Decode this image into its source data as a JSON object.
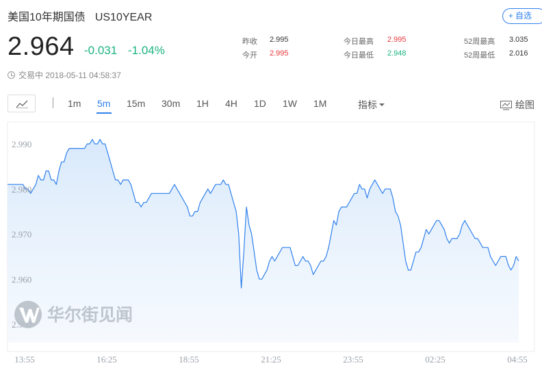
{
  "header": {
    "name": "美国10年期国债",
    "symbol": "US10YEAR",
    "fav_label": "自选",
    "fav_icon": "+",
    "price": "2.964",
    "change": "-0.031",
    "change_pct": "-1.04%",
    "status": "交易中 2018-05-11 04:58:37"
  },
  "stats": [
    {
      "label": "昨收",
      "value": "2.995",
      "tone": "dark"
    },
    {
      "label": "今开",
      "value": "2.995",
      "tone": "red"
    },
    {
      "label": "今日最高",
      "value": "2.995",
      "tone": "red"
    },
    {
      "label": "今日最低",
      "value": "2.948",
      "tone": "green"
    },
    {
      "label": "52周最高",
      "value": "3.035",
      "tone": "dark"
    },
    {
      "label": "52周最低",
      "value": "2.016",
      "tone": "dark"
    }
  ],
  "toolbar": {
    "tabs": [
      "1m",
      "5m",
      "15m",
      "30m",
      "1H",
      "4H",
      "1D",
      "1W",
      "1M"
    ],
    "active_tab": "5m",
    "indicator_label": "指标",
    "draw_label": "绘图"
  },
  "watermark": {
    "text": "华尔街见闻"
  },
  "colors": {
    "line": "#2f80ed",
    "up": "#e8353b",
    "down": "#19b37f",
    "accent": "#2f80ed"
  },
  "chart_data": {
    "type": "area",
    "y_ticks": [
      "2.990",
      "2.980",
      "2.970",
      "2.960",
      "2.950"
    ],
    "x_ticks": [
      "13:55",
      "16:25",
      "18:55",
      "21:25",
      "23:55",
      "02:25",
      "04:55"
    ],
    "ylim": [
      2.947,
      2.995
    ],
    "grid": false,
    "series": [
      {
        "values": [
          2.981,
          2.981,
          2.981,
          2.981,
          2.981,
          2.981,
          2.981,
          2.98,
          2.98,
          2.979,
          2.98,
          2.981,
          2.983,
          2.982,
          2.982,
          2.984,
          2.984,
          2.982,
          2.982,
          2.981,
          2.984,
          2.986,
          2.986,
          2.988,
          2.989,
          2.989,
          2.989,
          2.989,
          2.989,
          2.989,
          2.989,
          2.99,
          2.99,
          2.991,
          2.99,
          2.99,
          2.991,
          2.99,
          2.99,
          2.988,
          2.986,
          2.984,
          2.982,
          2.982,
          2.981,
          2.982,
          2.982,
          2.982,
          2.981,
          2.979,
          2.977,
          2.977,
          2.976,
          2.977,
          2.977,
          2.978,
          2.979,
          2.979,
          2.979,
          2.979,
          2.979,
          2.979,
          2.979,
          2.979,
          2.98,
          2.981,
          2.98,
          2.979,
          2.978,
          2.977,
          2.976,
          2.974,
          2.974,
          2.975,
          2.975,
          2.977,
          2.978,
          2.979,
          2.98,
          2.979,
          2.98,
          2.981,
          2.981,
          2.981,
          2.982,
          2.981,
          2.981,
          2.979,
          2.977,
          2.975,
          2.97,
          2.958,
          2.966,
          2.976,
          2.972,
          2.97,
          2.966,
          2.962,
          2.96,
          2.96,
          2.961,
          2.962,
          2.964,
          2.965,
          2.964,
          2.965,
          2.966,
          2.967,
          2.967,
          2.967,
          2.967,
          2.965,
          2.963,
          2.963,
          2.964,
          2.965,
          2.964,
          2.964,
          2.963,
          2.961,
          2.962,
          2.963,
          2.964,
          2.964,
          2.965,
          2.967,
          2.97,
          2.973,
          2.972,
          2.975,
          2.976,
          2.976,
          2.976,
          2.977,
          2.978,
          2.979,
          2.979,
          2.981,
          2.98,
          2.98,
          2.978,
          2.98,
          2.981,
          2.982,
          2.981,
          2.98,
          2.979,
          2.98,
          2.98,
          2.98,
          2.978,
          2.975,
          2.974,
          2.972,
          2.968,
          2.964,
          2.962,
          2.962,
          2.964,
          2.966,
          2.966,
          2.967,
          2.969,
          2.971,
          2.97,
          2.971,
          2.972,
          2.973,
          2.973,
          2.972,
          2.971,
          2.969,
          2.968,
          2.969,
          2.969,
          2.969,
          2.97,
          2.972,
          2.973,
          2.972,
          2.971,
          2.97,
          2.969,
          2.969,
          2.968,
          2.967,
          2.967,
          2.967,
          2.965,
          2.964,
          2.963,
          2.964,
          2.965,
          2.965,
          2.965,
          2.963,
          2.962,
          2.963,
          2.965,
          2.964
        ]
      }
    ]
  }
}
